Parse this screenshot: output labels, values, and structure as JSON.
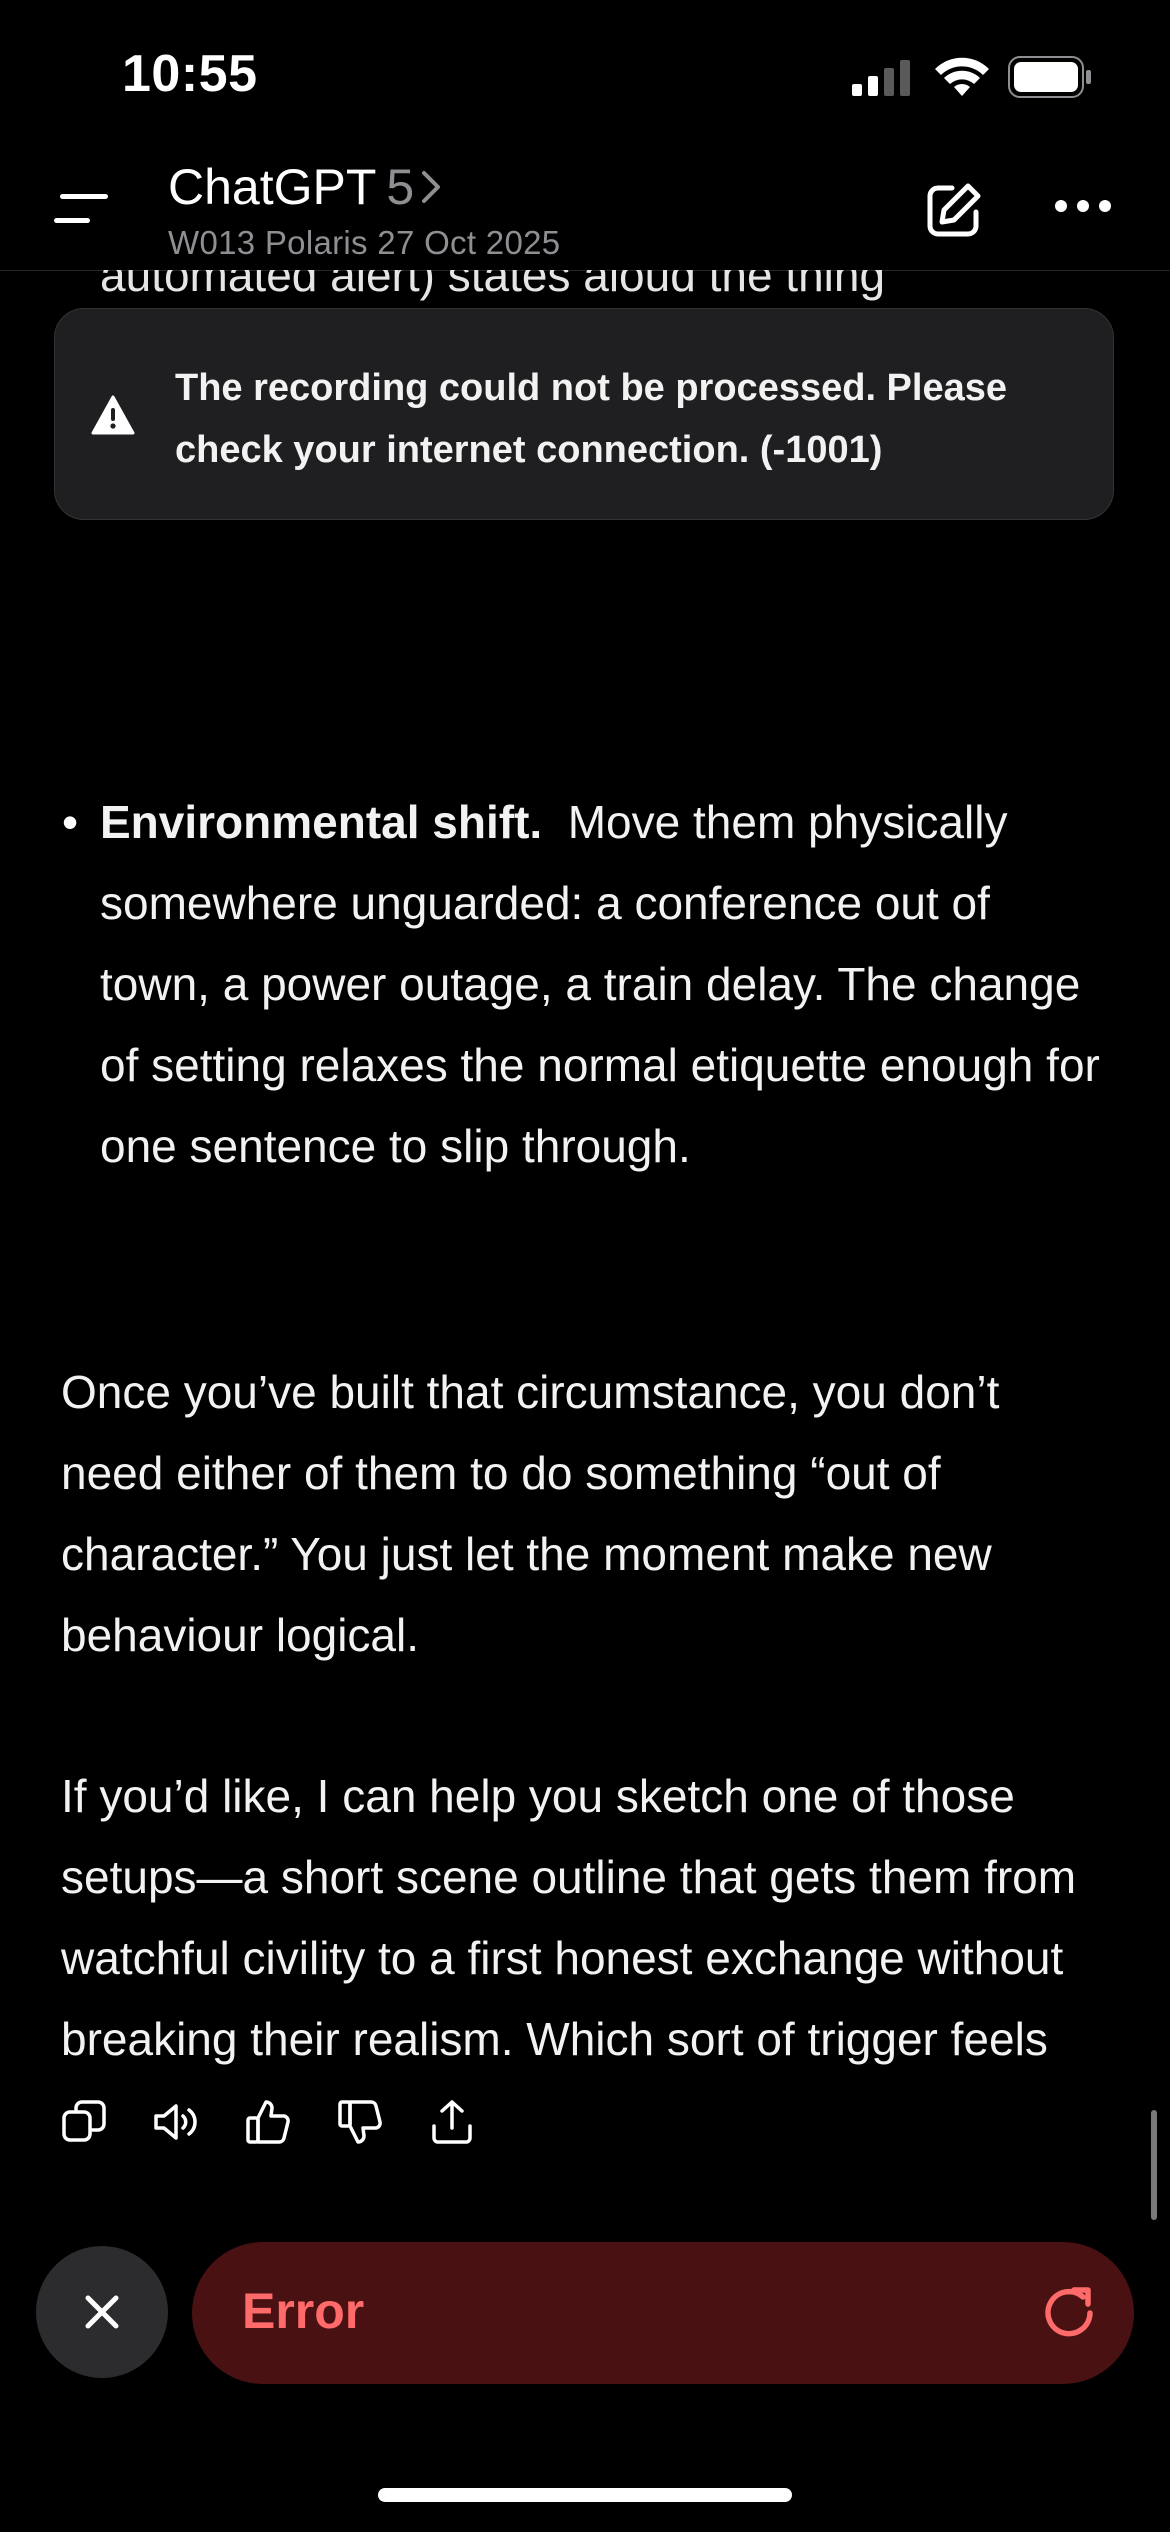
{
  "status_bar": {
    "time": "10:55"
  },
  "header": {
    "title": "ChatGPT",
    "model": "5",
    "subtitle": "W013 Polaris 27 Oct 2025"
  },
  "toast": {
    "message": "The recording could not be processed. Please check your internet connection. (-1001)"
  },
  "conversation": {
    "cut_off_line": "automated alert) states aloud the thing",
    "bullet": {
      "heading": "Environmental shift.",
      "text": "Move them physically somewhere unguarded: a conference out of town, a power outage, a train delay.  The change of setting relaxes the normal etiquette enough for one sentence to slip through."
    },
    "paragraph1": "Once you’ve built that circumstance, you don’t need either of them to do something “out of character.”  You just let the moment make new behaviour logical.",
    "paragraph2": "If you’d like, I can help you sketch one of those setups—a short scene outline that gets them from watchful civility to a first honest exchange without breaking their realism.  Which sort of trigger feels most natural for your version: a bureaucratic accident, a system glitch, or an external interruption?"
  },
  "actions": [
    "copy-icon",
    "read-aloud-icon",
    "thumbs-up-icon",
    "thumbs-down-icon",
    "share-icon"
  ],
  "composer": {
    "error_label": "Error"
  },
  "colors": {
    "background": "#000000",
    "error_bar": "#4a1113",
    "error_text": "#ff6a6a",
    "toast_bg": "#1f1f21"
  }
}
